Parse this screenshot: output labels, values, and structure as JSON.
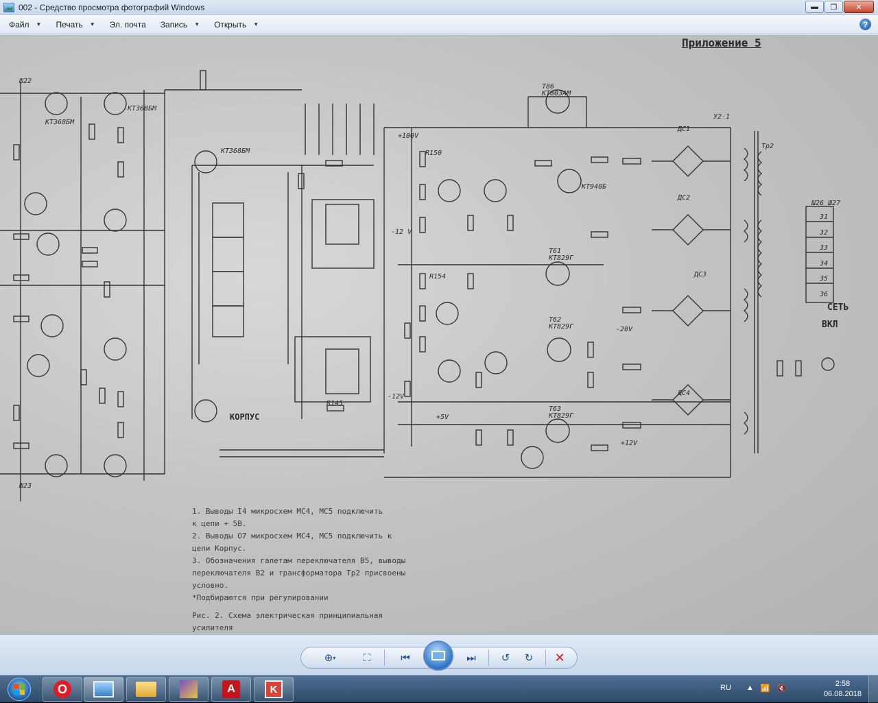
{
  "window": {
    "title": "002 - Средство просмотра фотографий Windows",
    "controls": {
      "minimize": "▬",
      "maximize": "❐",
      "close": "✕"
    }
  },
  "menu": {
    "items": [
      {
        "label": "Файл",
        "has_dropdown": true
      },
      {
        "label": "Печать",
        "has_dropdown": true
      },
      {
        "label": "Эл. почта",
        "has_dropdown": false
      },
      {
        "label": "Запись",
        "has_dropdown": true
      },
      {
        "label": "Открыть",
        "has_dropdown": true
      }
    ],
    "help": "?"
  },
  "scan": {
    "heading": "Приложение 5",
    "switch_labels": {
      "set": "СЕТЬ",
      "vkl": "ВКЛ",
      "korpus": "КОРПУС"
    },
    "notes": [
      "1. Выводы I4 микросхем МС4, МС5 подключить",
      "к цепи + 5В.",
      "2. Выводы O7 микросхем МС4, МС5 подключить к",
      "цепи Корпус.",
      "3. Обозначения галетам переключателя В5, выводы",
      "переключателя В2 и трансформатора Тр2 присвоены",
      "условно.",
      "*Подбираются при регулировании",
      "Рис. 2. Схема электрическая принципиальная",
      "усилителя"
    ]
  },
  "viewer_controls": {
    "zoom": "zoom-icon",
    "fit": "actual-size-icon",
    "previous": "previous-icon",
    "slideshow": "slideshow-icon",
    "next": "next-icon",
    "rotate_ccw": "rotate-left-icon",
    "rotate_cw": "rotate-right-icon",
    "delete": "delete-icon"
  },
  "taskbar": {
    "apps": [
      {
        "name": "opera",
        "icon": "O"
      },
      {
        "name": "photo-viewer",
        "icon": ""
      },
      {
        "name": "explorer",
        "icon": ""
      },
      {
        "name": "editor",
        "icon": ""
      },
      {
        "name": "acrobat",
        "icon": "A"
      },
      {
        "name": "app-red",
        "icon": "K"
      }
    ],
    "language": "RU",
    "time": "2:58",
    "date": "06.08.2018"
  },
  "colors": {
    "accent": "#2d74c8",
    "close": "#c7462f",
    "taskbar": "#2d4a6a"
  }
}
